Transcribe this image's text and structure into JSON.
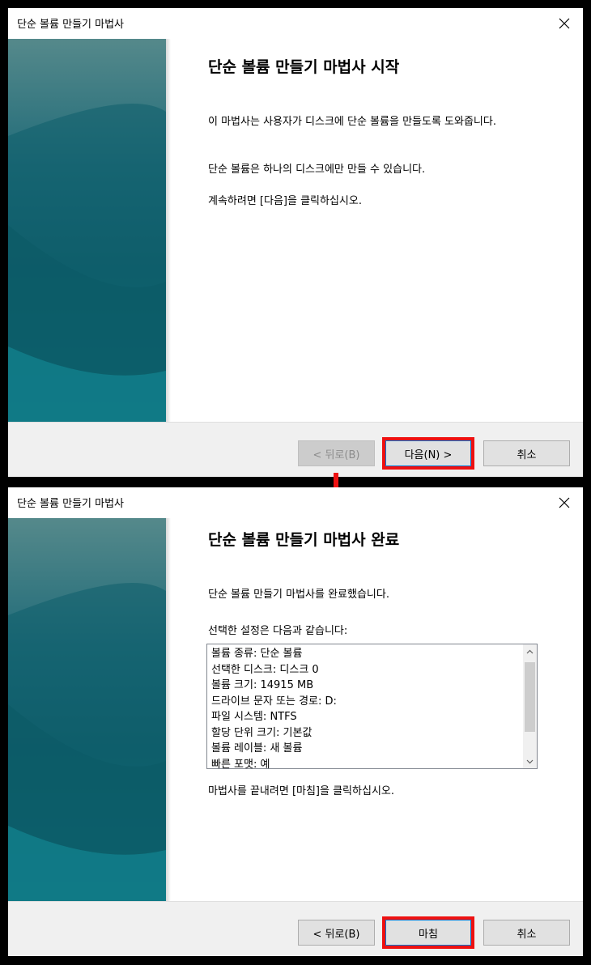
{
  "colors": {
    "highlight": "#ee1111",
    "arrow": "#ee1111"
  },
  "dialog1": {
    "title": "단순 볼륨 만들기 마법사",
    "heading": "단순 볼륨 만들기 마법사 시작",
    "para1": "이 마법사는 사용자가 디스크에 단순 볼륨을 만들도록 도와줍니다.",
    "para2": "단순 볼륨은 하나의 디스크에만 만들 수 있습니다.",
    "para3": "계속하려면 [다음]을 클릭하십시오.",
    "back_label": "< 뒤로(B)",
    "next_label": "다음(N) >",
    "cancel_label": "취소",
    "close_icon": "close-icon"
  },
  "dialog2": {
    "title": "단순 볼륨 만들기 마법사",
    "heading": "단순 볼륨 만들기 마법사 완료",
    "para1": "단순 볼륨 만들기 마법사를 완료했습니다.",
    "para2": "선택한 설정은 다음과 같습니다:",
    "summary": [
      "볼륨 종류: 단순 볼륨",
      "선택한 디스크: 디스크 0",
      "볼륨 크기: 14915 MB",
      "드라이브 문자 또는 경로: D:",
      "파일 시스템: NTFS",
      "할당 단위 크기: 기본값",
      "볼륨 레이블: 새 볼륨",
      "빠른 포맷: 예"
    ],
    "para3": "마법사를 끝내려면 [마침]을 클릭하십시오.",
    "back_label": "< 뒤로(B)",
    "finish_label": "마침",
    "cancel_label": "취소",
    "close_icon": "close-icon"
  }
}
